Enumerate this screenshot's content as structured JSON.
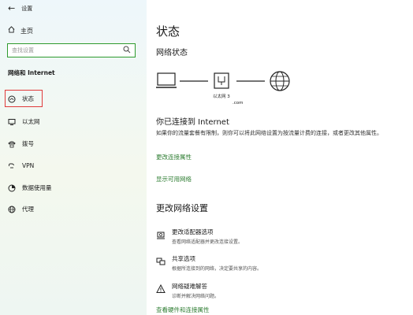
{
  "titlebar": {
    "back_icon": "back-arrow-icon",
    "title": "设置"
  },
  "sidebar": {
    "home_label": "主页",
    "search_placeholder": "查找设置",
    "section_title": "网络和 Internet",
    "items": [
      {
        "label": "状态",
        "icon": "status-globe-icon",
        "active": true
      },
      {
        "label": "以太网",
        "icon": "ethernet-monitor-icon",
        "active": false
      },
      {
        "label": "拨号",
        "icon": "dialup-phone-icon",
        "active": false
      },
      {
        "label": "VPN",
        "icon": "vpn-icon",
        "active": false
      },
      {
        "label": "数据使用量",
        "icon": "data-usage-icon",
        "active": false
      },
      {
        "label": "代理",
        "icon": "proxy-globe-icon",
        "active": false
      }
    ]
  },
  "main": {
    "title": "状态",
    "network_status_heading": "网络状态",
    "network_name": "以太网 3",
    "network_domain": ".com",
    "connected_heading": "你已连接到 Internet",
    "connected_desc": "如果你的流量套餐有限制，则你可以将此网络设置为按流量计费的连接，或者更改其他属性。",
    "link_change_props": "更改连接属性",
    "link_show_networks": "显示可用网络",
    "change_settings_heading": "更改网络设置",
    "options": [
      {
        "icon": "adapter-options-icon",
        "title": "更改适配器选项",
        "desc": "查看网络适配器并更改连接设置。"
      },
      {
        "icon": "sharing-options-icon",
        "title": "共享选项",
        "desc": "根据所连接到的网络，决定要共享的内容。"
      },
      {
        "icon": "troubleshooter-warning-icon",
        "title": "网络疑难解答",
        "desc": "诊断并解决网络问题。"
      }
    ],
    "link_hardware_props": "查看硬件和连接属性"
  },
  "colors": {
    "link_green": "#2e7d32",
    "search_border": "#2e9b2e",
    "active_border": "#e03a3a"
  }
}
